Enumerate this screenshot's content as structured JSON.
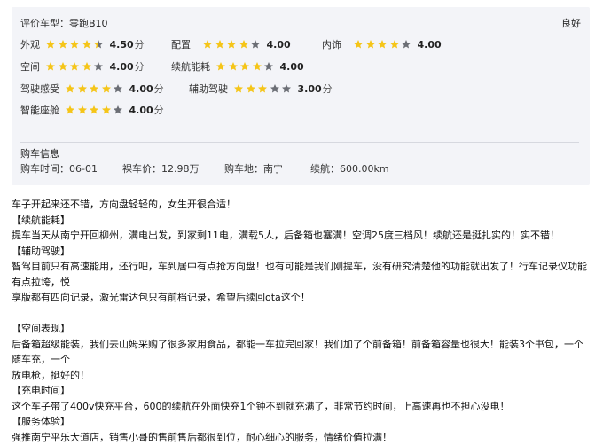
{
  "model": {
    "label": "评价车型：",
    "value": "零跑B10"
  },
  "overall": "良好",
  "score_unit": "分",
  "star_color": "#f5c518",
  "star_empty_color": "#6b6e75",
  "ratings": [
    {
      "label": "外观",
      "score": "4.50",
      "stars": 4.5,
      "show_unit": true
    },
    {
      "label": "配置",
      "score": "4.00",
      "stars": 4,
      "show_unit": false
    },
    {
      "label": "内饰",
      "score": "4.00",
      "stars": 4,
      "show_unit": false
    },
    {
      "label": "空间",
      "score": "4.00",
      "stars": 4,
      "show_unit": true
    },
    {
      "label": "续航能耗",
      "score": "4.00",
      "stars": 4,
      "show_unit": false
    },
    {
      "label": "驾驶感受",
      "score": "4.00",
      "stars": 4,
      "show_unit": true
    },
    {
      "label": "辅助驾驶",
      "score": "3.00",
      "stars": 3,
      "show_unit": true
    },
    {
      "label": "智能座舱",
      "score": "4.00",
      "stars": 4,
      "show_unit": true
    }
  ],
  "purchase": {
    "title": "购车信息",
    "time": {
      "label": "购车时间：",
      "value": "06-01"
    },
    "price": {
      "label": "裸车价：",
      "value": "12.98万"
    },
    "place": {
      "label": "购车地：",
      "value": "南宁"
    },
    "range": {
      "label": "续航：",
      "value": "600.00km"
    }
  },
  "review": [
    "车子开起来还不错，方向盘轻轻的，女生开很合适！",
    "【续航能耗】",
    "提车当天从南宁开回柳州，满电出发，到家剩11电，满载5人，后备箱也塞满！空调25度三档风！续航还是挺扎实的！实不错！",
    "【辅助驾驶】",
    "智驾目前只有高速能用，还行吧，车到居中有点抢方向盘！也有可能是我们刚提车，没有研究清楚他的功能就出发了！行车记录仪功能有点拉垮，悦",
    "享版都有四向记录，激光雷达包只有前档记录，希望后续回ota这个！",
    "",
    "【空间表现】",
    "后备箱超级能装，我们去山姆采购了很多家用食品，都能一车拉完回家！我们加了个前备箱！前备箱容量也很大！能装3个书包，一个随车充，一个",
    "放电枪，挺好的！",
    "【充电时间】",
    "这个车子带了400v快充平台，600的续航在外面快充1个钟不到就充满了，非常节约时间，上高速再也不担心没电！",
    "【服务体验】",
    "强推南宁平乐大道店，销售小哥的售前售后都很到位，耐心细心的服务，情绪价值拉满！"
  ]
}
